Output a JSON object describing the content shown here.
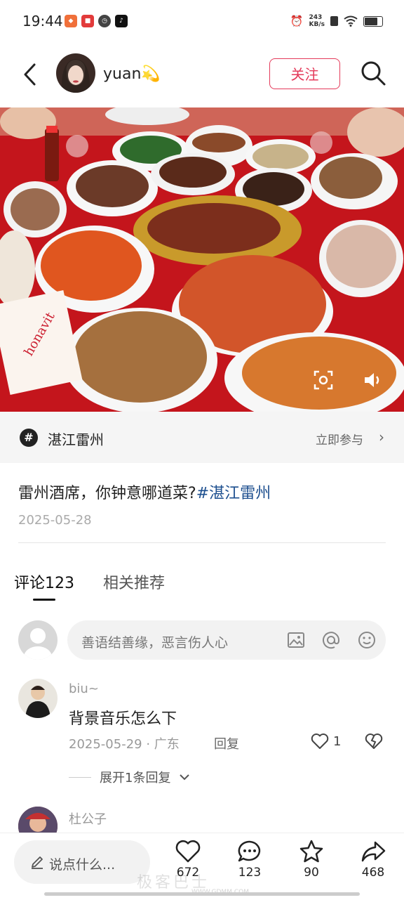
{
  "status_bar": {
    "time": "19:44",
    "speed_value": "243",
    "speed_unit": "KB/s"
  },
  "header": {
    "username": "yuan💫",
    "follow_label": "关注"
  },
  "topic": {
    "hash": "#",
    "name": "湛江雷州",
    "join_label": "立即参与",
    "chevron": "›"
  },
  "post": {
    "caption_text": "雷州酒席，你钟意哪道菜?",
    "caption_tag": "#湛江雷州",
    "date": "2025-05-28"
  },
  "tabs": {
    "comments_label": "评论123",
    "related_label": "相关推荐"
  },
  "comment_box": {
    "placeholder": "善语结善缘，恶言伤人心"
  },
  "comments": [
    {
      "user": "biu~",
      "text": "背景音乐怎么下",
      "meta": "2025-05-29 · 广东",
      "reply_label": "回复",
      "likes": "1",
      "expand_label": "展开1条回复"
    },
    {
      "user": "杜公子"
    }
  ],
  "bottom_bar": {
    "say_placeholder": "说点什么...",
    "likes": "672",
    "comments": "123",
    "favorites": "90",
    "shares": "468"
  },
  "watermark": {
    "text": "极客巴士",
    "url": "WWW.GDMM.COM"
  },
  "colors": {
    "accent": "#e43a5a",
    "tag_blue": "#1d4f8f",
    "tablecloth": "#c4151c"
  }
}
